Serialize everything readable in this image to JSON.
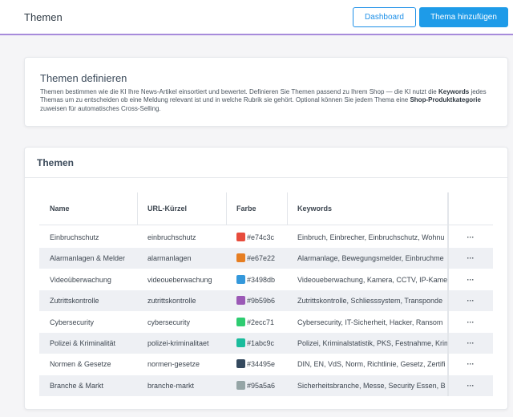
{
  "header": {
    "title": "Themen",
    "dashboard_label": "Dashboard",
    "add_label": "Thema hinzufügen"
  },
  "intro": {
    "title": "Themen definieren",
    "text_1": "Themen bestimmen wie die KI Ihre News-Artikel einsortiert und bewertet. Definieren Sie Themen passend zu Ihrem Shop — die KI nutzt die ",
    "bold_1": "Keywords",
    "text_2": " jedes Themas um zu entscheiden ob eine Meldung relevant ist und in welche Rubrik sie gehört. Optional können Sie jedem Thema eine ",
    "bold_2": "Shop-Produktkategorie",
    "text_3": " zuweisen für automatisches Cross-Selling."
  },
  "themes": {
    "title": "Themen",
    "columns": {
      "name": "Name",
      "slug": "URL-Kürzel",
      "color": "Farbe",
      "keywords": "Keywords"
    },
    "more_label": "···",
    "rows": [
      {
        "name": "Einbruchschutz",
        "slug": "einbruchschutz",
        "color": "#e74c3c",
        "keywords": "Einbruch, Einbrecher, Einbruchschutz, Wohnu"
      },
      {
        "name": "Alarmanlagen & Melder",
        "slug": "alarmanlagen",
        "color": "#e67e22",
        "keywords": "Alarmanlage, Bewegungsmelder, Einbruchme"
      },
      {
        "name": "Videoüberwachung",
        "slug": "videoueberwachung",
        "color": "#3498db",
        "keywords": "Videoueberwachung, Kamera, CCTV, IP-Kame"
      },
      {
        "name": "Zutrittskontrolle",
        "slug": "zutrittskontrolle",
        "color": "#9b59b6",
        "keywords": "Zutrittskontrolle, Schliesssystem, Transponde"
      },
      {
        "name": "Cybersecurity",
        "slug": "cybersecurity",
        "color": "#2ecc71",
        "keywords": "Cybersecurity, IT-Sicherheit, Hacker, Ransom"
      },
      {
        "name": "Polizei & Kriminalität",
        "slug": "polizei-kriminalitaet",
        "color": "#1abc9c",
        "keywords": "Polizei, Kriminalstatistik, PKS, Festnahme, Krim"
      },
      {
        "name": "Normen & Gesetze",
        "slug": "normen-gesetze",
        "color": "#34495e",
        "keywords": "DIN, EN, VdS, Norm, Richtlinie, Gesetz, Zertifi"
      },
      {
        "name": "Branche & Markt",
        "slug": "branche-markt",
        "color": "#95a5a6",
        "keywords": "Sicherheitsbranche, Messe, Security Essen, B"
      }
    ]
  }
}
